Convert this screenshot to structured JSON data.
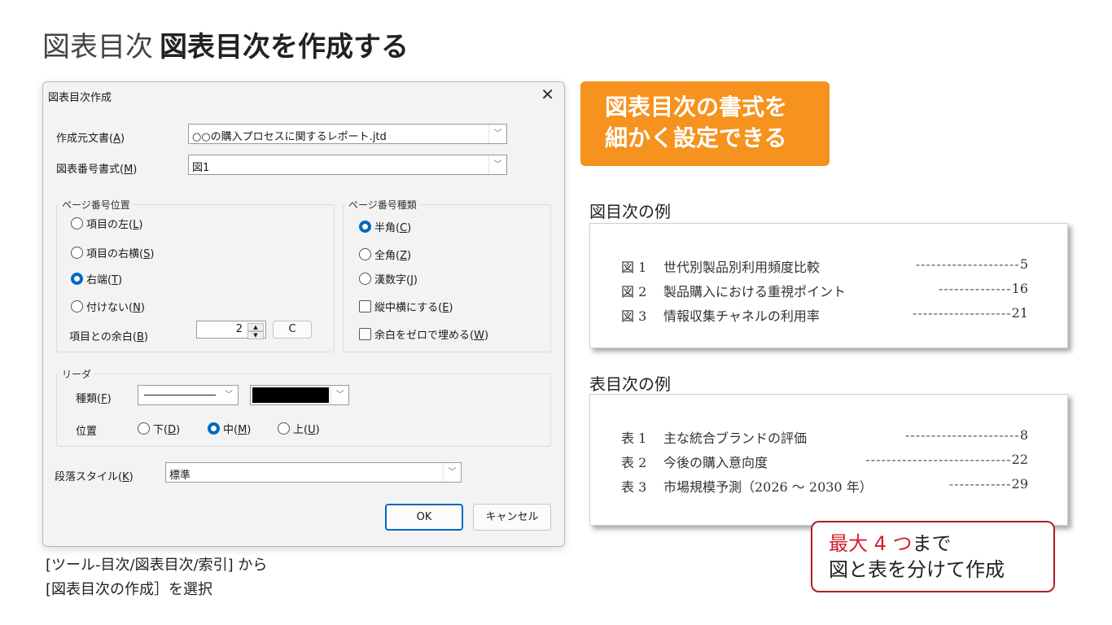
{
  "page": {
    "title_light": "図表目次",
    "title_bold": "図表目次を作成する",
    "caption_line1": "[ツール-目次/図表目次/索引] から",
    "caption_line2": "[図表目次の作成］を選択"
  },
  "dialog": {
    "title": "図表目次作成",
    "close": "✕",
    "source_label": "作成元文書(",
    "source_key": "A",
    "source_value": "○○の購入プロセスに関するレポート.jtd",
    "format_label": "図表番号書式(",
    "format_key": "M",
    "format_value": "図1",
    "page_pos_group": "ページ番号位置",
    "page_pos_options": [
      {
        "label": "項目の左(",
        "key": "L",
        "selected": false
      },
      {
        "label": "項目の右横(",
        "key": "S",
        "selected": false
      },
      {
        "label": "右端(",
        "key": "T",
        "selected": true
      },
      {
        "label": "付けない(",
        "key": "N",
        "selected": false
      }
    ],
    "margin_label": "項目との余白(",
    "margin_key": "B",
    "margin_value": "2",
    "margin_unit_button": "C",
    "page_type_group": "ページ番号種類",
    "page_type_options": [
      {
        "label": "半角(",
        "key": "C",
        "selected": true
      },
      {
        "label": "全角(",
        "key": "Z",
        "selected": false
      },
      {
        "label": "漢数字(",
        "key": "J",
        "selected": false
      }
    ],
    "checks": [
      {
        "label": "縦中横にする(",
        "key": "E",
        "checked": false
      },
      {
        "label": "余白をゼロで埋める(",
        "key": "W",
        "checked": false
      }
    ],
    "leader_group": "リーダ",
    "leader_type_label": "種類(",
    "leader_type_key": "F",
    "leader_color": "#000000",
    "leader_pos_label": "位置",
    "leader_pos_options": [
      {
        "label": "下(",
        "key": "D",
        "selected": false
      },
      {
        "label": "中(",
        "key": "M",
        "selected": true
      },
      {
        "label": "上(",
        "key": "U",
        "selected": false
      }
    ],
    "para_style_label": "段落スタイル(",
    "para_style_key": "K",
    "para_style_value": "標準",
    "ok": "OK",
    "cancel": "キャンセル"
  },
  "callout_orange": {
    "line1": "図表目次の書式を",
    "line2": "細かく設定できる",
    "color": "#f6921e"
  },
  "figure_toc": {
    "heading": "図目次の例",
    "rows": [
      {
        "num": "図 1",
        "title": "世代別製品別利用頻度比較",
        "leader": "--------------------",
        "page": "5"
      },
      {
        "num": "図 2",
        "title": "製品購入における重視ポイント",
        "leader": "--------------",
        "page": "16"
      },
      {
        "num": "図 3",
        "title": "情報収集チャネルの利用率",
        "leader": "-------------------",
        "page": "21"
      }
    ]
  },
  "table_toc": {
    "heading": "表目次の例",
    "rows": [
      {
        "num": "表 1",
        "title": "主な統合ブランドの評価",
        "leader": "----------------------",
        "page": "8"
      },
      {
        "num": "表 2",
        "title": "今後の購入意向度",
        "leader": "----------------------------",
        "page": "22"
      },
      {
        "num": "表 3",
        "title": "市場規模予測（2026 〜 2030 年）",
        "leader": "------------",
        "page": "29"
      }
    ]
  },
  "callout_red": {
    "max_text": "最大 4 つ",
    "max_rest": "まで",
    "line2": "図と表を分けて作成",
    "color": "#d0202e"
  }
}
